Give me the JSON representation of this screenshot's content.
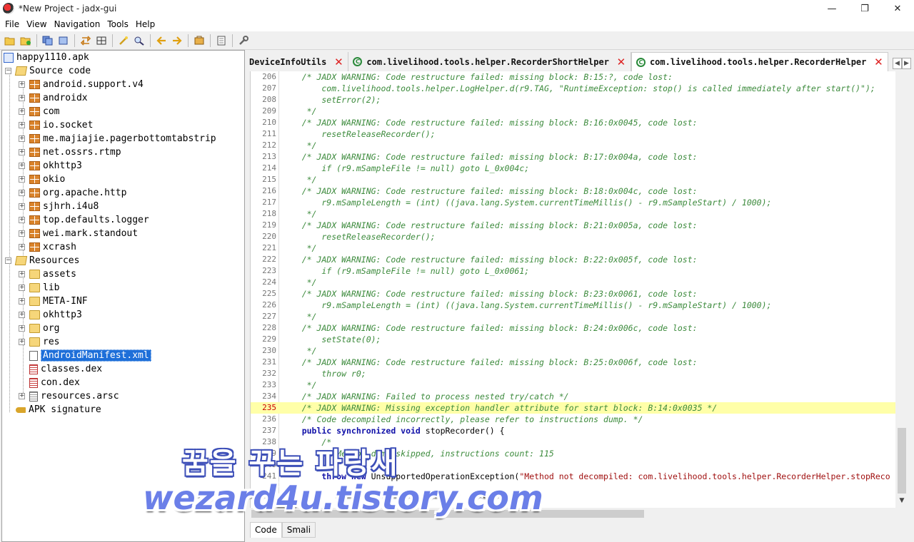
{
  "window": {
    "title": "*New Project - jadx-gui",
    "controls": {
      "minimize": "—",
      "maximize": "❐",
      "close": "✕"
    }
  },
  "menu": [
    "File",
    "View",
    "Navigation",
    "Tools",
    "Help"
  ],
  "toolbar": {
    "icons": [
      "open-folder-icon",
      "add-file-icon",
      "save-all-icon",
      "export-icon",
      "sync-icon",
      "flat-packages-icon",
      "wand-icon",
      "search-icon",
      "back-arrow-icon",
      "forward-arrow-icon",
      "log-icon",
      "preferences-icon",
      "settings-icon"
    ]
  },
  "tree": {
    "root": "happy1110.apk",
    "source_code": "Source code",
    "packages": [
      "android.support.v4",
      "androidx",
      "com",
      "io.socket",
      "me.majiajie.pagerbottomtabstrip",
      "net.ossrs.rtmp",
      "okhttp3",
      "okio",
      "org.apache.http",
      "sjhrh.i4u8",
      "top.defaults.logger",
      "wei.mark.standout",
      "xcrash"
    ],
    "resources": "Resources",
    "resource_folders": [
      "assets",
      "lib",
      "META-INF",
      "okhttp3",
      "org",
      "res"
    ],
    "resource_files": [
      "AndroidManifest.xml",
      "classes.dex",
      "con.dex",
      "resources.arsc"
    ],
    "apk_signature": "APK signature"
  },
  "tabs": [
    {
      "label": "DeviceInfoUtils",
      "icon": false,
      "active": false
    },
    {
      "label": "com.livelihood.tools.helper.RecorderShortHelper",
      "icon": true,
      "active": false
    },
    {
      "label": "com.livelihood.tools.helper.RecorderHelper",
      "icon": true,
      "active": true
    }
  ],
  "code": {
    "lines": [
      {
        "n": "206",
        "t": "    /* JADX WARNING: Code restructure failed: missing block: B:15:?, code lost:",
        "c": "cmt"
      },
      {
        "n": "207",
        "t": "        com.livelihood.tools.helper.LogHelper.d(r9.TAG, \"RuntimeException: stop() is called immediately after start()\");",
        "c": "cmt"
      },
      {
        "n": "208",
        "t": "        setError(2);",
        "c": "cmt"
      },
      {
        "n": "209",
        "t": "     */",
        "c": "cmt"
      },
      {
        "n": "210",
        "t": "    /* JADX WARNING: Code restructure failed: missing block: B:16:0x0045, code lost:",
        "c": "cmt"
      },
      {
        "n": "211",
        "t": "        resetReleaseRecorder();",
        "c": "cmt"
      },
      {
        "n": "212",
        "t": "     */",
        "c": "cmt"
      },
      {
        "n": "213",
        "t": "    /* JADX WARNING: Code restructure failed: missing block: B:17:0x004a, code lost:",
        "c": "cmt"
      },
      {
        "n": "214",
        "t": "        if (r9.mSampleFile != null) goto L_0x004c;",
        "c": "cmt"
      },
      {
        "n": "215",
        "t": "     */",
        "c": "cmt"
      },
      {
        "n": "216",
        "t": "    /* JADX WARNING: Code restructure failed: missing block: B:18:0x004c, code lost:",
        "c": "cmt"
      },
      {
        "n": "217",
        "t": "        r9.mSampleLength = (int) ((java.lang.System.currentTimeMillis() - r9.mSampleStart) / 1000);",
        "c": "cmt"
      },
      {
        "n": "218",
        "t": "     */",
        "c": "cmt"
      },
      {
        "n": "219",
        "t": "    /* JADX WARNING: Code restructure failed: missing block: B:21:0x005a, code lost:",
        "c": "cmt"
      },
      {
        "n": "220",
        "t": "        resetReleaseRecorder();",
        "c": "cmt"
      },
      {
        "n": "221",
        "t": "     */",
        "c": "cmt"
      },
      {
        "n": "222",
        "t": "    /* JADX WARNING: Code restructure failed: missing block: B:22:0x005f, code lost:",
        "c": "cmt"
      },
      {
        "n": "223",
        "t": "        if (r9.mSampleFile != null) goto L_0x0061;",
        "c": "cmt"
      },
      {
        "n": "224",
        "t": "     */",
        "c": "cmt"
      },
      {
        "n": "225",
        "t": "    /* JADX WARNING: Code restructure failed: missing block: B:23:0x0061, code lost:",
        "c": "cmt"
      },
      {
        "n": "226",
        "t": "        r9.mSampleLength = (int) ((java.lang.System.currentTimeMillis() - r9.mSampleStart) / 1000);",
        "c": "cmt"
      },
      {
        "n": "227",
        "t": "     */",
        "c": "cmt"
      },
      {
        "n": "228",
        "t": "    /* JADX WARNING: Code restructure failed: missing block: B:24:0x006c, code lost:",
        "c": "cmt"
      },
      {
        "n": "229",
        "t": "        setState(0);",
        "c": "cmt"
      },
      {
        "n": "230",
        "t": "     */",
        "c": "cmt"
      },
      {
        "n": "231",
        "t": "    /* JADX WARNING: Code restructure failed: missing block: B:25:0x006f, code lost:",
        "c": "cmt"
      },
      {
        "n": "232",
        "t": "        throw r0;",
        "c": "cmt"
      },
      {
        "n": "233",
        "t": "     */",
        "c": "cmt"
      },
      {
        "n": "234",
        "t": "    /* JADX WARNING: Failed to process nested try/catch */",
        "c": "cmt"
      },
      {
        "n": "235",
        "t": "    /* JADX WARNING: Missing exception handler attribute for start block: B:14:0x0035 */",
        "c": "cmt",
        "hl": true
      },
      {
        "n": "236",
        "t": "    /* Code decompiled incorrectly, please refer to instructions dump. */",
        "c": "cmt"
      },
      {
        "n": "237",
        "parts": [
          [
            "kw",
            "    public synchronized void "
          ],
          [
            "",
            "stopRecorder() {"
          ]
        ]
      },
      {
        "n": "238",
        "t": "        /*",
        "c": "cmt"
      },
      {
        "n": "239",
        "t": "        // Method dump skipped, instructions count: 115",
        "c": "cmt"
      },
      {
        "n": "240",
        "t": "",
        "c": ""
      },
      {
        "n": "241",
        "parts": [
          [
            "kw",
            "        throw new "
          ],
          [
            "",
            "UnsupportedOperationException("
          ],
          [
            "str",
            "\"Method not decompiled: com.livelihood.tools.helper.RecorderHelper.stopReco"
          ]
        ]
      }
    ]
  },
  "bottom_tabs": [
    "Code",
    "Smali"
  ],
  "watermark": {
    "line1": "꿈을 꾸는 파랑새",
    "line2": "wezard4u.tistory.com"
  }
}
